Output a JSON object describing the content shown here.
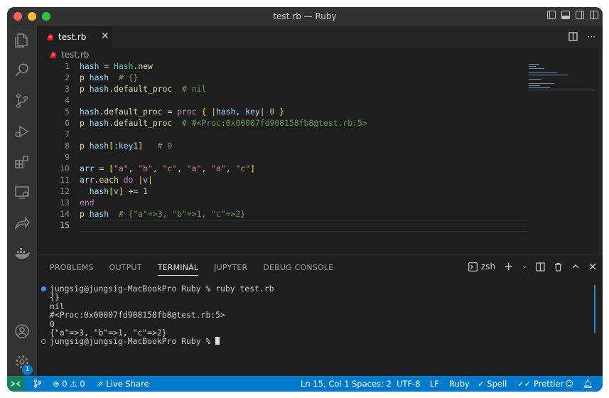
{
  "window": {
    "title": "test.rb — Ruby"
  },
  "tab": {
    "name": "test.rb",
    "close": "✕"
  },
  "breadcrumb": {
    "file": "test.rb"
  },
  "editor": {
    "lines": [
      {
        "n": "1",
        "code": "hash = Hash.new"
      },
      {
        "n": "2",
        "code": "p hash  # {}"
      },
      {
        "n": "3",
        "code": "p hash.default_proc  # nil"
      },
      {
        "n": "4",
        "code": ""
      },
      {
        "n": "5",
        "code": "hash.default_proc = proc { |hash, key| 0 }"
      },
      {
        "n": "6",
        "code": "p hash.default_proc  # #<Proc:0x00007fd908158fb8@test.rb:5>"
      },
      {
        "n": "7",
        "code": ""
      },
      {
        "n": "8",
        "code": "p hash[:key1]   # 0"
      },
      {
        "n": "9",
        "code": ""
      },
      {
        "n": "10",
        "code": "arr = [\"a\", \"b\", \"c\", \"a\", \"a\", \"c\"]"
      },
      {
        "n": "11",
        "code": "arr.each do |v|"
      },
      {
        "n": "12",
        "code": "  hash[v] += 1"
      },
      {
        "n": "13",
        "code": "end"
      },
      {
        "n": "14",
        "code": "p hash  # {\"a\"=>3, \"b\"=>1, \"c\"=>2}"
      },
      {
        "n": "15",
        "code": ""
      }
    ]
  },
  "panel": {
    "tabs": [
      "PROBLEMS",
      "OUTPUT",
      "TERMINAL",
      "JUPYTER",
      "DEBUG CONSOLE"
    ],
    "active_tab": "TERMINAL",
    "shell": "zsh",
    "terminal_lines": [
      "jungsig@jungsig-MacBookPro Ruby % ruby test.rb",
      "{}",
      "nil",
      "#<Proc:0x00007fd908158fb8@test.rb:5>",
      "0",
      "{\"a\"=>3, \"b\"=>1, \"c\"=>2}",
      "jungsig@jungsig-MacBookPro Ruby % "
    ]
  },
  "statusbar": {
    "errors": "0",
    "warnings": "0",
    "live_share": "Live Share",
    "position": "Ln 15, Col 1",
    "spaces": "Spaces: 2",
    "encoding": "UTF-8",
    "eol": "LF",
    "language": "Ruby",
    "spell": "Spell",
    "prettier": "Prettier"
  },
  "activity": {
    "settings_badge": "1"
  },
  "colors": {
    "accent": "#007acc",
    "remote": "#16825d",
    "editor_bg": "#1e1e1e"
  }
}
